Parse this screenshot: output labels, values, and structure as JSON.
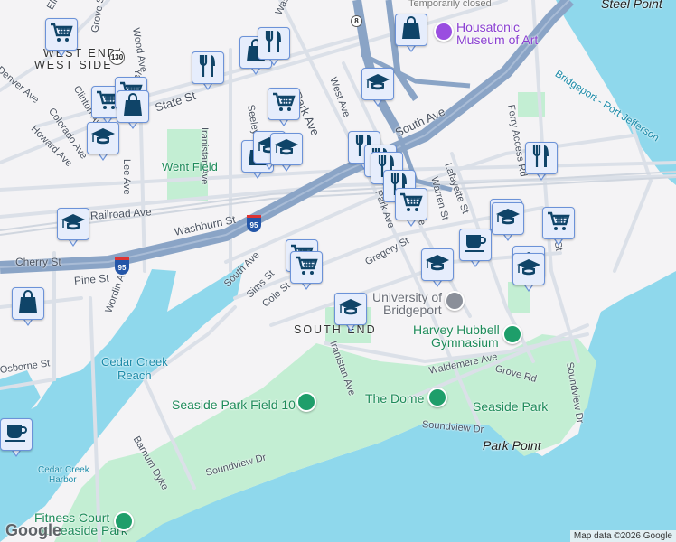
{
  "map": {
    "attribution": "Map data ©2026 Google",
    "logo": "Google",
    "colors": {
      "water": "#8fd8ec",
      "park": "#c3eed3",
      "highway": "#8aa4c6",
      "road": "#dbe0e8",
      "land": "#f4f3f5",
      "marker_fill": "#e6edfc",
      "marker_border": "#6b92d8",
      "marker_icon": "#0f4468"
    },
    "areas": {
      "west_end_1": "WEST END/",
      "west_end_2": "WEST SIDE",
      "south_end": "SOUTH END",
      "steel_point": "Steel Point",
      "park_point": "Park Point"
    },
    "streets": {
      "elm": "Elm St",
      "grove": "Grove St",
      "wood": "Wood Ave",
      "washington": "Washington Ave",
      "denver": "Denver Ave",
      "clinton": "Clinton Ave",
      "yale": "Yale St",
      "colorado": "Colorado Ave",
      "howard": "Howard Ave",
      "state": "State St",
      "lee": "Lee Ave",
      "iranistan": "Iranistan Ave",
      "seeley": "Seeley St",
      "park": "Park Ave",
      "west": "West Ave",
      "south": "South Ave",
      "warren": "Warren St",
      "lafayette": "Lafayette St",
      "myrtle": "Myrtle Ave",
      "ferry": "Ferry Access Rd",
      "railroad": "Railroad Ave",
      "washburn": "Washburn St",
      "cherry": "Cherry St",
      "pine": "Pine St",
      "wordin": "Wordin Ave",
      "south2": "South Ave",
      "sims": "Sims St",
      "cole": "Cole St",
      "gregory": "Gregory St",
      "park2": "Park Ave",
      "iranistan2": "Iranistan Ave",
      "osborne": "Osborne St",
      "waldemere": "Waldemere Ave",
      "grove_rd": "Grove Rd",
      "soundview": "Soundview Dr",
      "soundview2": "Soundview Dr",
      "soundview3": "Soundview Dr",
      "barnum": "Barnum Dyke",
      "ferry_route": "Bridgeport - Port Jefferson",
      "main": "Main St"
    },
    "shields": {
      "r130": "130",
      "r8": "8",
      "i95a": "95",
      "i95b": "95"
    },
    "water_labels": {
      "cedar_reach_1": "Cedar Creek",
      "cedar_reach_2": "Reach",
      "cedar_harbor_1": "Cedar Creek",
      "cedar_harbor_2": "Harbor"
    },
    "parks": {
      "went": "Went Field"
    },
    "pois": {
      "museum_1": "Housatonic",
      "museum_2": "Museum of Art",
      "temp_closed": "Temporarily closed",
      "university_1": "University of",
      "university_2": "Bridgeport",
      "gym_1": "Harvey Hubbell",
      "gym_2": "Gymnasium",
      "field10": "Seaside Park Field 10",
      "dome": "The Dome",
      "seaside": "Seaside Park",
      "fitness_1": "Fitness Court",
      "fitness_2": "at Seaside Park"
    },
    "markers": [
      "cart",
      "cart",
      "cart",
      "bag",
      "school",
      "food",
      "bag",
      "food",
      "cart",
      "bag",
      "school",
      "school",
      "school",
      "bag",
      "food",
      "food",
      "food",
      "food",
      "cart",
      "food",
      "school",
      "school",
      "cart",
      "coffee",
      "school",
      "school",
      "school",
      "cart",
      "cart",
      "school",
      "bag",
      "coffee",
      "school"
    ]
  }
}
